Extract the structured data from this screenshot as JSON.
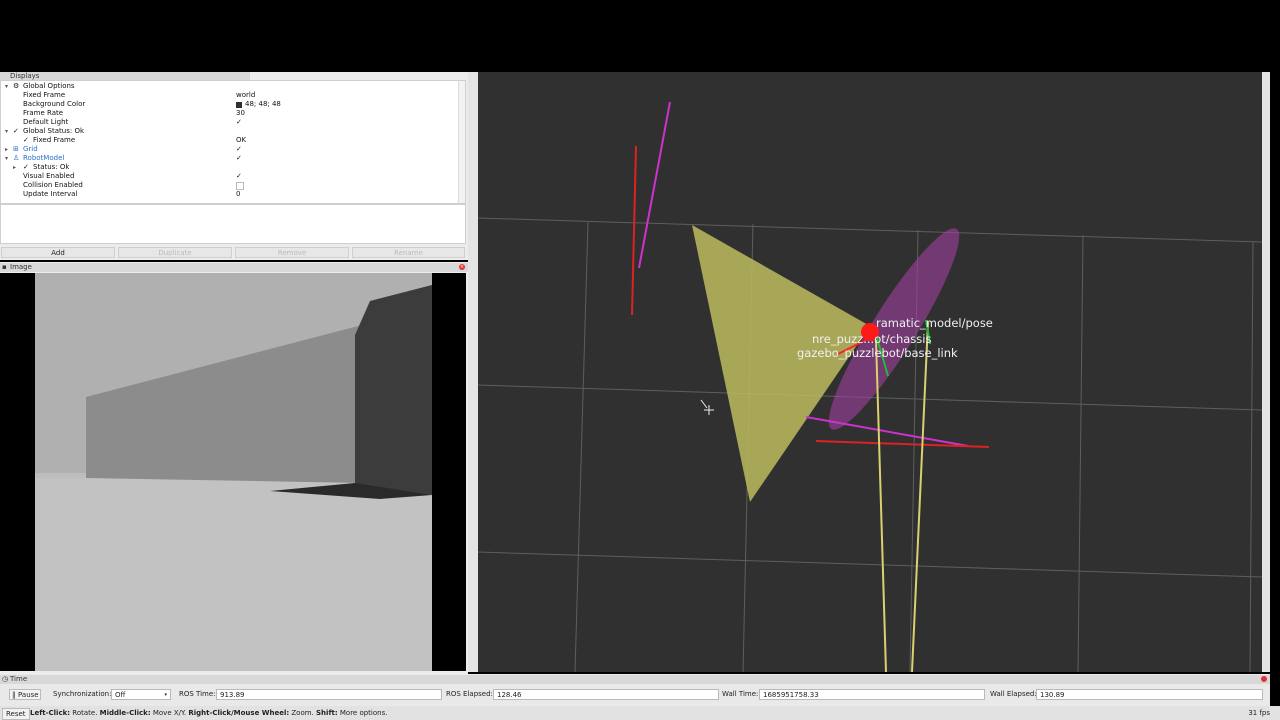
{
  "displays": {
    "title": "Displays",
    "rows": [
      {
        "label": "Global Options",
        "value": ""
      },
      {
        "label": "Fixed Frame",
        "value": "world"
      },
      {
        "label": "Background Color",
        "value": "48; 48; 48"
      },
      {
        "label": "Frame Rate",
        "value": "30"
      },
      {
        "label": "Default Light",
        "value": "✓"
      },
      {
        "label": "Global Status: Ok",
        "value": ""
      },
      {
        "label": "Fixed Frame",
        "value": "OK"
      },
      {
        "label": "Grid",
        "value": "✓"
      },
      {
        "label": "RobotModel",
        "value": "✓"
      },
      {
        "label": "Status: Ok",
        "value": ""
      },
      {
        "label": "Visual Enabled",
        "value": "✓"
      },
      {
        "label": "Collision Enabled",
        "value": ""
      },
      {
        "label": "Update Interval",
        "value": "0"
      }
    ],
    "buttons": {
      "add": "Add",
      "duplicate": "Duplicate",
      "remove": "Remove",
      "rename": "Rename"
    }
  },
  "image_panel": {
    "title": "Image"
  },
  "viewport": {
    "frame_labels": [
      "ramatic_model/pose",
      "nre_puzz...ot/chassis",
      "gazebo_puzzlebot/base_link"
    ]
  },
  "time_panel": {
    "title": "Time",
    "pause_label": "Pause",
    "sync_label": "Synchronization:",
    "sync_value": "Off",
    "ros_time_label": "ROS Time:",
    "ros_time": "913.89",
    "ros_elapsed_label": "ROS Elapsed:",
    "ros_elapsed": "128.46",
    "wall_time_label": "Wall Time:",
    "wall_time": "1685951758.33",
    "wall_elapsed_label": "Wall Elapsed:",
    "wall_elapsed": "130.89"
  },
  "status_bar": {
    "reset": "Reset",
    "help_left": "Left-Click:",
    "help_left_action": " Rotate. ",
    "help_middle": "Middle-Click:",
    "help_middle_action": " Move X/Y. ",
    "help_right": "Right-Click/Mouse Wheel:",
    "help_right_action": " Zoom. ",
    "help_shift": "Shift:",
    "help_shift_action": " More options.",
    "fps": "31 fps"
  },
  "colors": {
    "background": "#303030",
    "accent_blue": "#2a6fc9"
  }
}
